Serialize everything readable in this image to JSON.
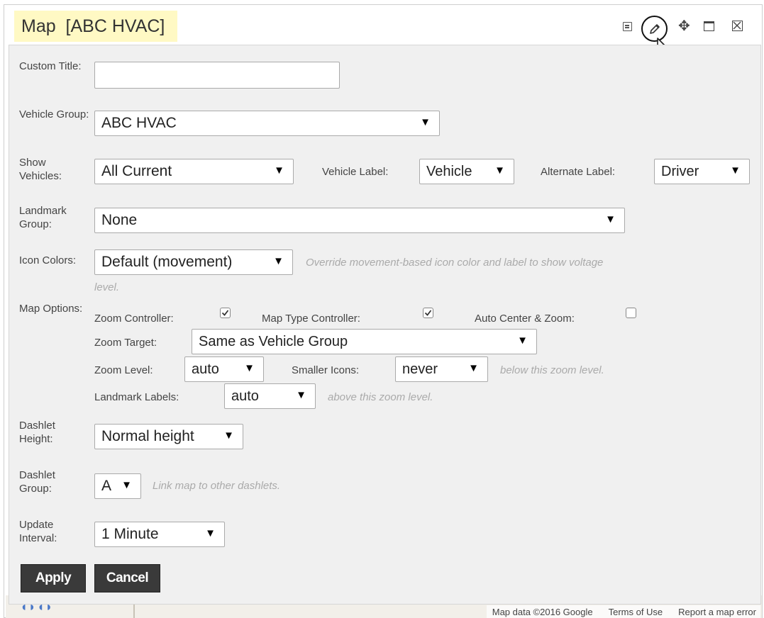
{
  "window": {
    "title": "Map  [ABC HVAC]"
  },
  "toolbar": {
    "icons": [
      "copy-icon",
      "edit-icon",
      "move-icon",
      "maximize-icon",
      "close-icon"
    ]
  },
  "form": {
    "custom_title": {
      "label": "Custom Title:",
      "value": ""
    },
    "vehicle_group": {
      "label": "Vehicle Group:",
      "value": "ABC HVAC"
    },
    "show_vehicles": {
      "label": "Show Vehicles:",
      "value": "All Current",
      "vehicle_label": {
        "label": "Vehicle Label:",
        "value": "Vehicle"
      },
      "alternate_label": {
        "label": "Alternate Label:",
        "value": "Driver"
      }
    },
    "landmark_group": {
      "label": "Landmark Group:",
      "value": "None"
    },
    "icon_colors": {
      "label": "Icon Colors:",
      "value": "Default (movement)",
      "hint_line1": "Override movement-based icon color and label to show voltage",
      "hint_line2": "level."
    },
    "map_options": {
      "label": "Map Options:",
      "zoom_controller": {
        "label": "Zoom Controller:",
        "checked": true
      },
      "map_type_controller": {
        "label": "Map Type Controller:",
        "checked": true
      },
      "auto_center_zoom": {
        "label": "Auto Center & Zoom:",
        "checked": false
      },
      "zoom_target": {
        "label": "Zoom Target:",
        "value": "Same as Vehicle Group"
      },
      "zoom_level": {
        "label": "Zoom Level:",
        "value": "auto"
      },
      "smaller_icons": {
        "label": "Smaller Icons:",
        "value": "never",
        "hint": "below this zoom level."
      },
      "landmark_labels": {
        "label": "Landmark Labels:",
        "value": "auto",
        "hint": "above this zoom level."
      }
    },
    "dashlet_height": {
      "label": "Dashlet Height:",
      "value": "Normal height"
    },
    "dashlet_group": {
      "label": "Dashlet Group:",
      "value": "A",
      "hint": "Link map to other dashlets."
    },
    "update_interval": {
      "label": "Update Interval:",
      "value": "1 Minute"
    }
  },
  "buttons": {
    "apply": "Apply",
    "cancel": "Cancel"
  },
  "map_footer": {
    "map_data": "Map data ©2016 Google",
    "terms": "Terms of Use",
    "report": "Report a map error"
  },
  "colors": {
    "title_bg": "#fff9c4",
    "panel_bg": "#f0f0f0",
    "button_bg": "#3a3a3a"
  }
}
